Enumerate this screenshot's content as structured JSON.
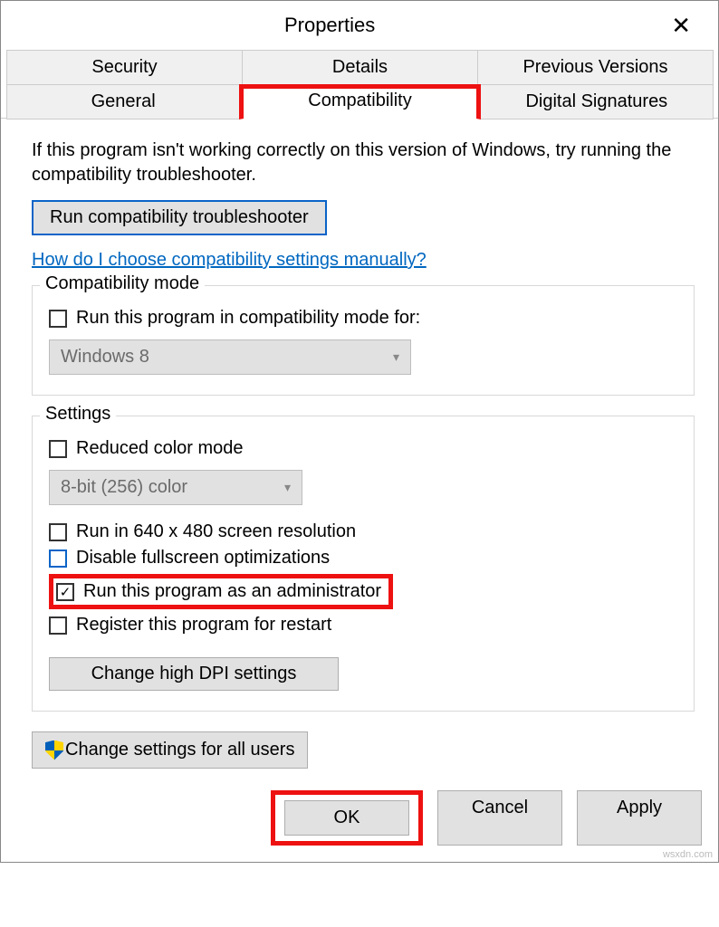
{
  "title": "Properties",
  "tabs": {
    "row1": [
      "Security",
      "Details",
      "Previous Versions"
    ],
    "row2": [
      "General",
      "Compatibility",
      "Digital Signatures"
    ],
    "active": "Compatibility"
  },
  "intro": "If this program isn't working correctly on this version of Windows, try running the compatibility troubleshooter.",
  "troubleshooter_btn": "Run compatibility troubleshooter",
  "help_link": "How do I choose compatibility settings manually?",
  "compat_group": {
    "title": "Compatibility mode",
    "checkbox": "Run this program in compatibility mode for:",
    "select": "Windows 8"
  },
  "settings_group": {
    "title": "Settings",
    "reduced_color": "Reduced color mode",
    "color_select": "8-bit (256) color",
    "run_640": "Run in 640 x 480 screen resolution",
    "disable_fullscreen": "Disable fullscreen optimizations",
    "run_admin": "Run this program as an administrator",
    "register_restart": "Register this program for restart",
    "dpi_btn": "Change high DPI settings"
  },
  "all_users_btn": "Change settings for all users",
  "footer": {
    "ok": "OK",
    "cancel": "Cancel",
    "apply": "Apply"
  },
  "watermark": "wsxdn.com"
}
